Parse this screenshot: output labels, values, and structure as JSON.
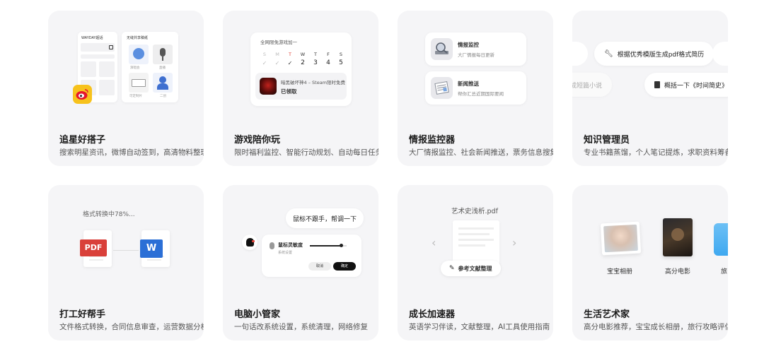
{
  "cards": [
    {
      "title": "追星好搭子",
      "desc": "搜索明星资讯，微博自动签到，高清物料整理",
      "left_panel_title": "WAYDAY超话",
      "right_panel_title": "无缝共享稿纸",
      "tiles": [
        "演唱会",
        "直播",
        "可定制片",
        "二创"
      ]
    },
    {
      "title": "游戏陪你玩",
      "desc": "限时福利监控、智能行动规划、自动每日任务",
      "calendar_title": "全网限免游戏加一",
      "days": [
        "S",
        "M",
        "T",
        "W",
        "T",
        "F",
        "S"
      ],
      "dates": [
        "2",
        "3",
        "4",
        "5"
      ],
      "game_name": "暗黑破坏神4 – Steam限时免费",
      "game_status": "已领取"
    },
    {
      "title": "情报监控器",
      "desc": "大厂情报监控、社会新闻推送，票务信息搜集",
      "items": [
        {
          "title": "情报监控",
          "sub": "大厂情报每日更新"
        },
        {
          "title": "新闻推送",
          "sub": "帮你汇总近期国际要闻"
        }
      ]
    },
    {
      "title": "知识管理员",
      "desc": "专业书籍蒸馏，个人笔记提炼，求职资料筹备",
      "chip1": "根据优秀模版生成pdf格式简历",
      "chip2": "把笔记提炼成短篇小说",
      "chip3": "概括一下《时间简史》"
    },
    {
      "title": "打工好帮手",
      "desc": "文件格式转换，合同信息审查，运营数据分析",
      "progress_text": "格式转换中78%...",
      "progress": 0.78,
      "from_label": "PDF",
      "to_label": "W"
    },
    {
      "title": "电脑小管家",
      "desc": "一句话改系统设置，系统清理，网络修复",
      "bubble": "鼠标不跟手，帮调一下",
      "setting_title": "鼠标灵敏度",
      "setting_sub": "系统设置",
      "slider_value": 0.85,
      "cancel": "取消",
      "confirm": "确定"
    },
    {
      "title": "成长加速器",
      "desc": "英语学习伴读，文献整理，AI工具使用指南",
      "file_name": "艺术史浅析.pdf",
      "action": "参考文献整理"
    },
    {
      "title": "生活艺术家",
      "desc": "高分电影推荐，宝宝成长相册，旅行攻略评估",
      "albums": [
        "宝宝相册",
        "高分电影",
        "旅"
      ]
    }
  ],
  "colors": {
    "card_bg": "#f5f5f7",
    "pdf_red": "#d9403a",
    "word_blue": "#2b6fd6",
    "weibo_yellow": "#f7c21c",
    "calendar_red": "#e0443a",
    "folder_blue": "#3fa8f0"
  }
}
